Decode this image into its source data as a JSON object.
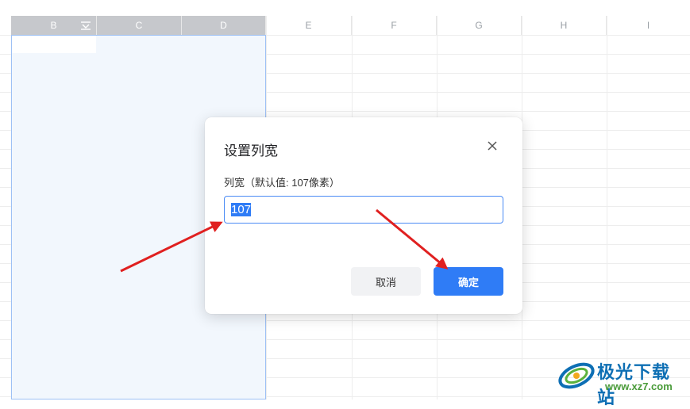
{
  "spreadsheet": {
    "columns": [
      "B",
      "C",
      "D",
      "E",
      "F",
      "G",
      "H",
      "I"
    ]
  },
  "dialog": {
    "title": "设置列宽",
    "field_label": "列宽（默认值: 107像素）",
    "input_value": "107",
    "cancel_label": "取消",
    "ok_label": "确定"
  },
  "watermark": {
    "title": "极光下载站",
    "url": "www.xz7.com"
  },
  "colors": {
    "accent": "#2f7cf6",
    "selected_header": "#c6c8cc",
    "selection_fill": "#f2f7fd",
    "arrow": "#e02020"
  }
}
